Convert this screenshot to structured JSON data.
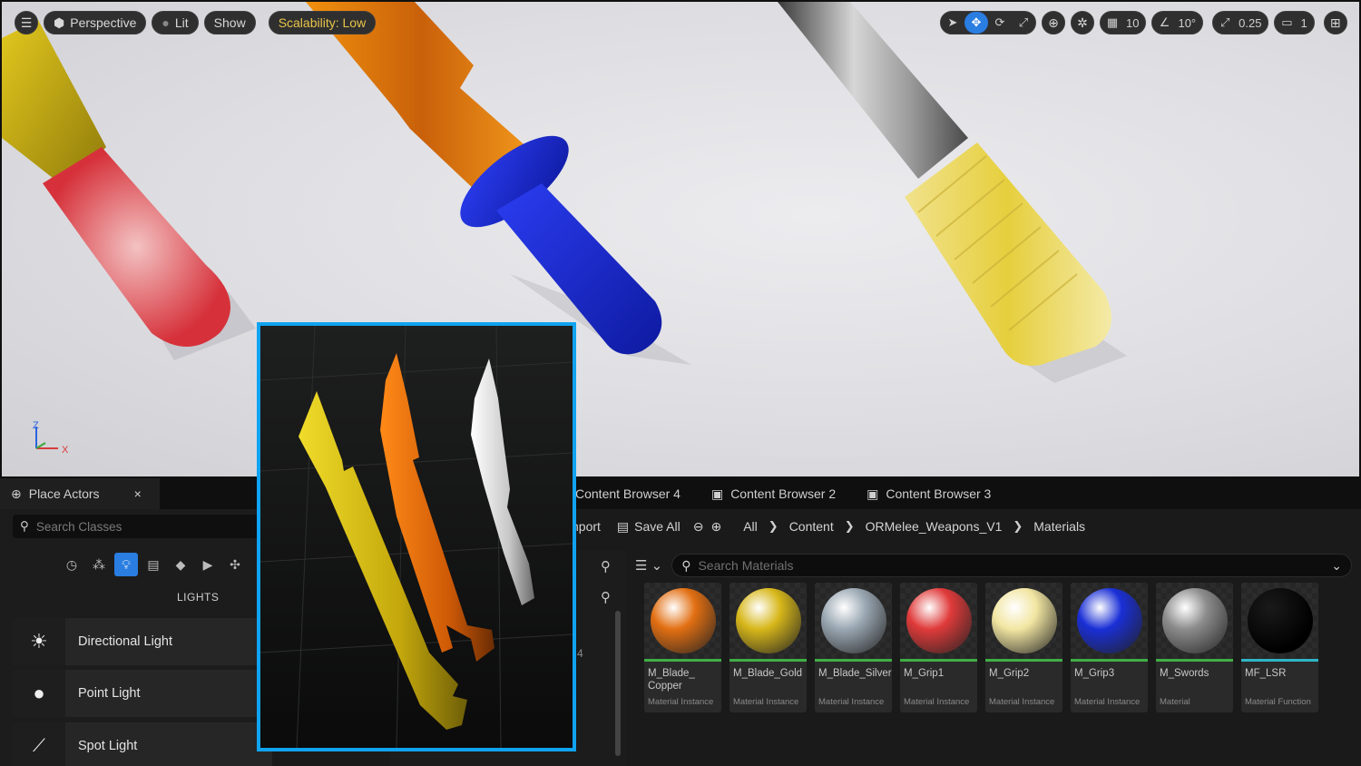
{
  "viewport": {
    "perspective_label": "Perspective",
    "lit_label": "Lit",
    "show_label": "Show",
    "scalability_label": "Scalability: Low",
    "grid_snap_value": "10",
    "rotation_snap_value": "10°",
    "scale_snap_value": "0.25",
    "camera_speed_value": "1",
    "axis": {
      "z": "Z",
      "x": "X"
    }
  },
  "place_actors": {
    "tab_label": "Place Actors",
    "close": "×",
    "search_placeholder": "Search Classes",
    "section_label": "LIGHTS",
    "actors": [
      "Directional Light",
      "Point Light",
      "Spot Light"
    ]
  },
  "content_browser": {
    "tabs": [
      "Content Browser 4",
      "Content Browser 2",
      "Content Browser 3"
    ],
    "import_label": "nport",
    "save_all_label": "Save All",
    "breadcrumb": [
      "All",
      "Content",
      "ORMelee_Weapons_V1",
      "Materials"
    ],
    "search_placeholder": "Search Materials",
    "stray_digit": "4",
    "assets": [
      {
        "name": "M_Blade_ Copper",
        "type": "Material Instance",
        "color": "#e26f12",
        "bar": "#3fae46"
      },
      {
        "name": "M_Blade_Gold",
        "type": "Material Instance",
        "color": "#d7b71a",
        "bar": "#3fae46"
      },
      {
        "name": "M_Blade_Silver",
        "type": "Material Instance",
        "color": "#9aa7b2",
        "bar": "#3fae46"
      },
      {
        "name": "M_Grip1",
        "type": "Material Instance",
        "color": "#e03a3a",
        "bar": "#3fae46"
      },
      {
        "name": "M_Grip2",
        "type": "Material Instance",
        "color": "#f2e6a2",
        "bar": "#3fae46"
      },
      {
        "name": "M_Grip3",
        "type": "Material Instance",
        "color": "#1a2fd6",
        "bar": "#3fae46"
      },
      {
        "name": "M_Swords",
        "type": "Material",
        "color": "#8c8c8c",
        "bar": "#3fae46"
      },
      {
        "name": "MF_LSR",
        "type": "Material Function",
        "color": "#050505",
        "bar": "#2fb6c8"
      }
    ]
  },
  "colors": {
    "accent": "#2a7de1",
    "preview_border": "#10a3f0",
    "scalability": "#e8c44a"
  }
}
